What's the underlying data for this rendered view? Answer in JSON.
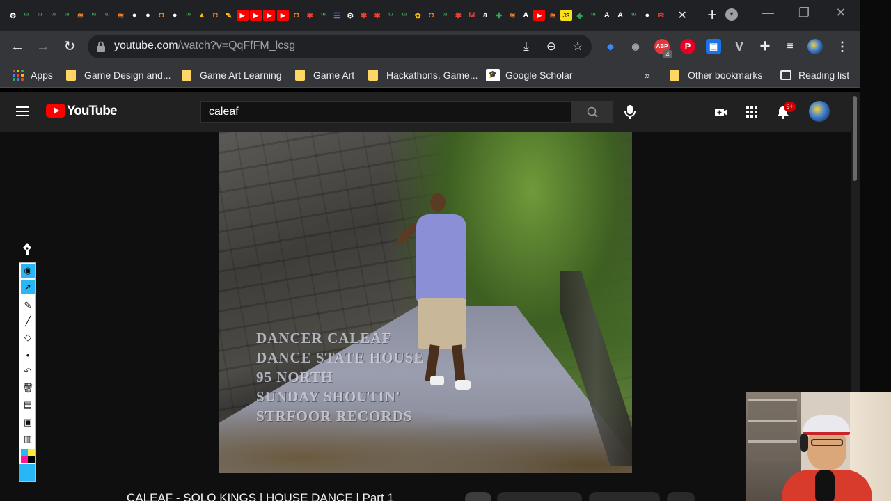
{
  "browser": {
    "tab_favicons": [
      {
        "icon": "gear-icon",
        "color": "#ffffff"
      },
      {
        "icon": "coursera-icon",
        "color": "#34a853"
      },
      {
        "icon": "coursera-icon",
        "color": "#34a853"
      },
      {
        "icon": "coursera-icon",
        "color": "#34a853"
      },
      {
        "icon": "coursera-icon",
        "color": "#34a853"
      },
      {
        "icon": "stack-icon",
        "color": "#f48024"
      },
      {
        "icon": "coursera-icon",
        "color": "#34a853"
      },
      {
        "icon": "coursera-icon",
        "color": "#34a853"
      },
      {
        "icon": "stack-icon",
        "color": "#f48024"
      },
      {
        "icon": "head-icon",
        "color": "#ffffff"
      },
      {
        "icon": "head-icon",
        "color": "#ffffff"
      },
      {
        "icon": "orange-icon",
        "color": "#f28b30"
      },
      {
        "icon": "head-icon",
        "color": "#ffffff"
      },
      {
        "icon": "coursera-icon",
        "color": "#34a853"
      },
      {
        "icon": "drive-icon",
        "color": "#fbbc04"
      },
      {
        "icon": "orange-icon",
        "color": "#f28b30"
      },
      {
        "icon": "pen-icon",
        "color": "#fbbc04"
      },
      {
        "icon": "youtube-icon",
        "color": "#ff0000"
      },
      {
        "icon": "youtube-icon",
        "color": "#ff0000"
      },
      {
        "icon": "youtube-icon",
        "color": "#ff0000"
      },
      {
        "icon": "youtube-icon",
        "color": "#ff0000"
      },
      {
        "icon": "orange-icon",
        "color": "#f28b30"
      },
      {
        "icon": "asterisk-icon",
        "color": "#ea4335"
      },
      {
        "icon": "coursera-icon",
        "color": "#34a853"
      },
      {
        "icon": "docs-icon",
        "color": "#4285f4"
      },
      {
        "icon": "gear-icon",
        "color": "#ffffff"
      },
      {
        "icon": "asterisk-icon",
        "color": "#ea4335"
      },
      {
        "icon": "asterisk-icon",
        "color": "#ea4335"
      },
      {
        "icon": "coursera-icon",
        "color": "#34a853"
      },
      {
        "icon": "coursera-icon",
        "color": "#34a853"
      },
      {
        "icon": "photos-icon",
        "color": "#fbbc04"
      },
      {
        "icon": "orange-icon",
        "color": "#f28b30"
      },
      {
        "icon": "coursera-icon",
        "color": "#34a853"
      },
      {
        "icon": "asterisk-icon",
        "color": "#ea4335"
      },
      {
        "icon": "m-icon",
        "color": "#ea4335"
      },
      {
        "icon": "amazon-icon",
        "color": "#ffffff"
      },
      {
        "icon": "bot-icon",
        "color": "#34a853"
      },
      {
        "icon": "stack-icon",
        "color": "#f48024"
      },
      {
        "icon": "a-icon",
        "color": "#ffffff"
      },
      {
        "icon": "youtube-icon",
        "color": "#ff0000"
      },
      {
        "icon": "stack-icon",
        "color": "#f48024"
      },
      {
        "icon": "js-icon",
        "color": "#f7df1e"
      },
      {
        "icon": "shield-icon",
        "color": "#34a853"
      },
      {
        "icon": "coursera-icon",
        "color": "#34a853"
      },
      {
        "icon": "a-icon",
        "color": "#ffffff"
      },
      {
        "icon": "a-icon",
        "color": "#ffffff"
      },
      {
        "icon": "coursera-icon",
        "color": "#34a853"
      },
      {
        "icon": "head-icon",
        "color": "#ffffff"
      },
      {
        "icon": "gmail-icon",
        "color": "#ea4335"
      }
    ],
    "url_host": "youtube.com",
    "url_path": "/watch?v=QqFfFM_lcsg",
    "bookmarks": [
      {
        "label": "Apps",
        "type": "apps"
      },
      {
        "label": "Game Design and...",
        "type": "folder"
      },
      {
        "label": "Game Art Learning",
        "type": "folder"
      },
      {
        "label": "Game Art",
        "type": "folder"
      },
      {
        "label": "Hackathons, Game...",
        "type": "folder"
      },
      {
        "label": "Google Scholar",
        "type": "scholar"
      }
    ],
    "overflow": "»",
    "other_bookmarks": "Other bookmarks",
    "reading_list": "Reading list",
    "extension_badge_count": "4",
    "extension_abp_label": "ABP"
  },
  "youtube": {
    "logo_text": "YouTube",
    "search_value": "caleaf",
    "notification_count": "9+",
    "video_title": "CALEAF - SOLO KINGS | HOUSE DANCE | Part 1",
    "video_overlay_lines": [
      "DANCER CALEAF",
      "DANCE STATE HOUSE",
      "95 NORTH",
      "SUNDAY SHOUTIN'",
      "STRFOOR RECORDS"
    ]
  },
  "colors": {
    "accent": "#29b6f6",
    "youtube_red": "#ff0000",
    "chrome_bg": "#202124",
    "toolbar_bg": "#35363a"
  }
}
